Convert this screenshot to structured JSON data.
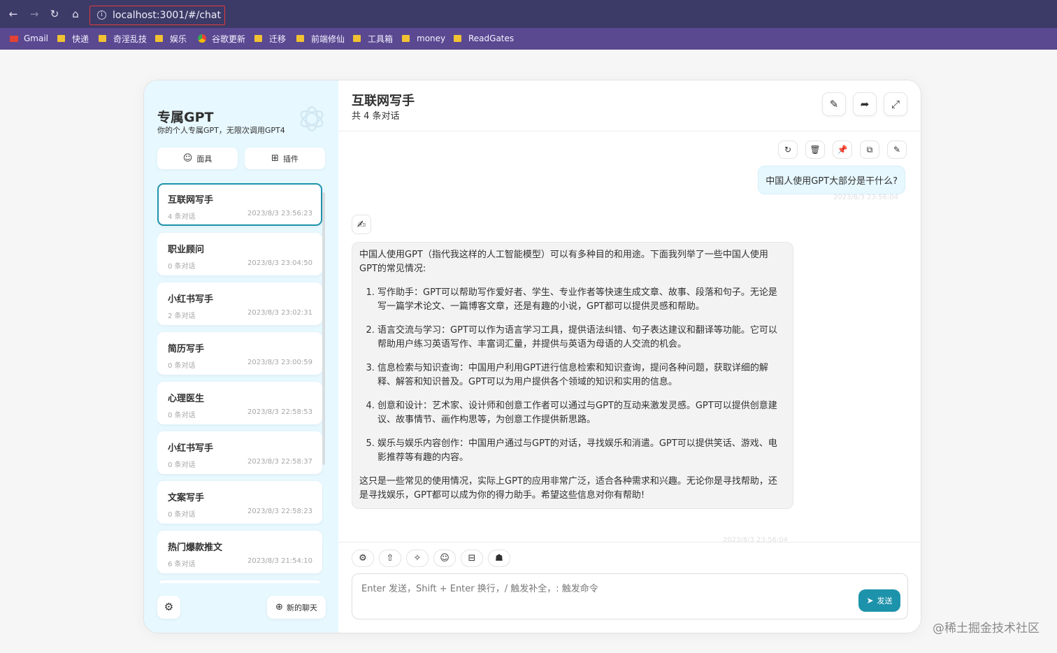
{
  "browser": {
    "url": "localhost:3001/#/chat",
    "bookmarks": [
      "Gmail",
      "快递",
      "奇淫乱技",
      "娱乐",
      "谷歌更新",
      "迁移",
      "前端修仙",
      "工具箱",
      "money",
      "ReadGates"
    ]
  },
  "sidebar": {
    "title": "专属GPT",
    "subtitle": "你的个人专属GPT，无限次调用GPT4",
    "mask_button": "面具",
    "plugin_button": "插件",
    "sessions": [
      {
        "title": "互联网写手",
        "count": "4 条对话",
        "date": "2023/8/3 23:56:23"
      },
      {
        "title": "职业顾问",
        "count": "0 条对话",
        "date": "2023/8/3 23:04:50"
      },
      {
        "title": "小红书写手",
        "count": "2 条对话",
        "date": "2023/8/3 23:02:31"
      },
      {
        "title": "简历写手",
        "count": "0 条对话",
        "date": "2023/8/3 23:00:59"
      },
      {
        "title": "心理医生",
        "count": "0 条对话",
        "date": "2023/8/3 22:58:53"
      },
      {
        "title": "小红书写手",
        "count": "0 条对话",
        "date": "2023/8/3 22:58:37"
      },
      {
        "title": "文案写手",
        "count": "0 条对话",
        "date": "2023/8/3 22:58:23"
      },
      {
        "title": "热门爆款推文",
        "count": "6 条对话",
        "date": "2023/8/3 21:54:10"
      }
    ],
    "new_chat_button": "新的聊天"
  },
  "chat": {
    "title": "互联网写手",
    "subtitle": "共 4 条对话",
    "user_message": "中国人使用GPT大部分是干什么?",
    "user_date": "2023/8/3 23:56:04",
    "bot_avatar": "✍",
    "bot_intro": "中国人使用GPT（指代我这样的人工智能模型）可以有多种目的和用途。下面我列举了一些中国人使用GPT的常见情况:",
    "bot_items": [
      "写作助手：GPT可以帮助写作爱好者、学生、专业作者等快速生成文章、故事、段落和句子。无论是写一篇学术论文、一篇博客文章，还是有趣的小说，GPT都可以提供灵感和帮助。",
      "语言交流与学习：GPT可以作为语言学习工具，提供语法纠错、句子表达建议和翻译等功能。它可以帮助用户练习英语写作、丰富词汇量，并提供与英语为母语的人交流的机会。",
      "信息检索与知识查询：中国用户利用GPT进行信息检索和知识查询，提问各种问题，获取详细的解释、解答和知识普及。GPT可以为用户提供各个领域的知识和实用的信息。",
      "创意和设计：艺术家、设计师和创意工作者可以通过与GPT的互动来激发灵感。GPT可以提供创意建议、故事情节、画作构思等，为创意工作提供新思路。",
      "娱乐与娱乐内容创作：中国用户通过与GPT的对话，寻找娱乐和消遣。GPT可以提供笑话、游戏、电影推荐等有趣的内容。"
    ],
    "bot_outro": "这只是一些常见的使用情况，实际上GPT的应用非常广泛，适合各种需求和兴趣。无论你是寻找帮助，还是寻找娱乐，GPT都可以成为你的得力助手。希望这些信息对你有帮助!",
    "bot_date": "2023/8/3 23:56:04",
    "input_placeholder": "Enter 发送，Shift + Enter 换行，/ 触发补全，: 触发命令",
    "send_button": "发送"
  },
  "watermark": "@稀土掘金技术社区",
  "colors": {
    "accent": "#1d93ab",
    "sidebar_bg": "#e7f8ff",
    "topbar": "#3c3a67",
    "bookmarks_bar": "#5a4891"
  }
}
